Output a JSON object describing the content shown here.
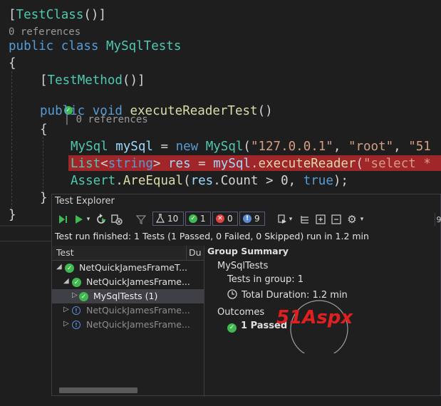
{
  "code": {
    "attr_testclass": "TestClass",
    "refs_class": "0 references",
    "kw_public": "public",
    "kw_class": "class",
    "class_name": "MySqlTests",
    "attr_testmethod": "TestMethod",
    "refs_method": "| 0 references",
    "kw_void": "void",
    "method_name": "executeReaderTest",
    "type_mysql": "MySql",
    "var_mysql": "mySql",
    "kw_new": "new",
    "str_host": "\"127.0.0.1\"",
    "str_user": "\"root\"",
    "str_partial": "\"51",
    "type_list": "List",
    "type_string": "string",
    "var_res": "res",
    "method_exec": "executeReader",
    "str_select": "\"select *",
    "type_assert": "Assert",
    "method_areequal": "AreEqual",
    "prop_count": "Count",
    "num_zero": "0",
    "kw_true": "true"
  },
  "test_explorer": {
    "title": "Test Explorer",
    "counts": {
      "total": "10",
      "passed": "1",
      "failed": "0",
      "info": "9"
    },
    "status": "Test run finished: 1 Tests (1 Passed, 0 Failed, 0 Skipped) run in 1.2 min",
    "columns": {
      "test": "Test",
      "duration": "Du"
    },
    "tree": [
      {
        "label": "NetQuickJamesFrameT...",
        "state": "pass"
      },
      {
        "label": "NetQuickJamesFrame...",
        "state": "pass"
      },
      {
        "label": "MySqlTests (1)",
        "state": "pass"
      },
      {
        "label": "NetQuickJamesFrame...",
        "state": "info"
      },
      {
        "label": "NetQuickJamesFrame...",
        "state": "info"
      }
    ],
    "summary": {
      "heading": "Group Summary",
      "group": "MySqlTests",
      "tests_in_group": "Tests in group:  1",
      "total_duration": "Total Duration:  1.2 min",
      "outcomes": "Outcomes",
      "passed": "1 Passed"
    },
    "edge_value": "9"
  },
  "watermark": {
    "text": "51Aspx"
  },
  "colors": {
    "pass": "#3fb950",
    "fail": "#e0433f",
    "info": "#5c8ad6",
    "highlight": "#a1262a",
    "brand_green": "#2fb52f",
    "brand_red": "#e02020"
  }
}
